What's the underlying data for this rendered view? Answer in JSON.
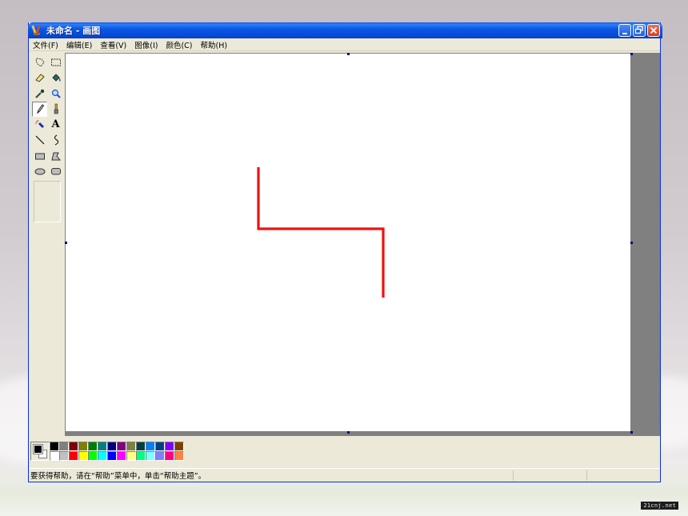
{
  "window": {
    "title": "未命名 - 画图",
    "caption_buttons": [
      "minimize",
      "restore",
      "close"
    ]
  },
  "menubar": {
    "items": [
      {
        "label": "文件(F)"
      },
      {
        "label": "编辑(E)"
      },
      {
        "label": "查看(V)"
      },
      {
        "label": "图像(I)"
      },
      {
        "label": "颜色(C)"
      },
      {
        "label": "帮助(H)"
      }
    ]
  },
  "toolbox": {
    "tools": [
      {
        "name": "free-form-select",
        "icon": "free-select-icon"
      },
      {
        "name": "select",
        "icon": "rect-select-icon"
      },
      {
        "name": "eraser",
        "icon": "eraser-icon"
      },
      {
        "name": "fill",
        "icon": "fill-bucket-icon"
      },
      {
        "name": "pick-color",
        "icon": "eyedropper-icon"
      },
      {
        "name": "magnifier",
        "icon": "magnifier-icon"
      },
      {
        "name": "pencil",
        "icon": "pencil-icon",
        "active": true
      },
      {
        "name": "brush",
        "icon": "brush-icon"
      },
      {
        "name": "airbrush",
        "icon": "airbrush-icon"
      },
      {
        "name": "text",
        "icon": "text-icon",
        "glyph": "A"
      },
      {
        "name": "line",
        "icon": "line-icon"
      },
      {
        "name": "curve",
        "icon": "curve-icon"
      },
      {
        "name": "rectangle",
        "icon": "rectangle-icon"
      },
      {
        "name": "polygon",
        "icon": "polygon-icon"
      },
      {
        "name": "ellipse",
        "icon": "ellipse-icon"
      },
      {
        "name": "rounded-rectangle",
        "icon": "rounded-rect-icon"
      }
    ]
  },
  "drawing": {
    "stroke_color": "#ee1111",
    "description_shape": "red polyline"
  },
  "palette": {
    "foreground": "#000000",
    "background": "#ffffff",
    "top_row": [
      "#000000",
      "#808080",
      "#800000",
      "#808000",
      "#008000",
      "#008080",
      "#000080",
      "#800080",
      "#808040",
      "#004040",
      "#0080ff",
      "#004080",
      "#8000ff",
      "#804000"
    ],
    "bottom_row": [
      "#ffffff",
      "#c0c0c0",
      "#ff0000",
      "#ffff00",
      "#00ff00",
      "#00ffff",
      "#0000ff",
      "#ff00ff",
      "#ffff80",
      "#00ff80",
      "#80ffff",
      "#8080ff",
      "#ff0080",
      "#ff8040"
    ]
  },
  "statusbar": {
    "text": "要获得帮助，请在“帮助”菜单中，单击“帮助主题”。"
  },
  "colors": {
    "titlebar": "#0b58e3",
    "chrome": "#ece9d8",
    "canvas_bg": "#ffffff",
    "workspace": "#808080"
  }
}
